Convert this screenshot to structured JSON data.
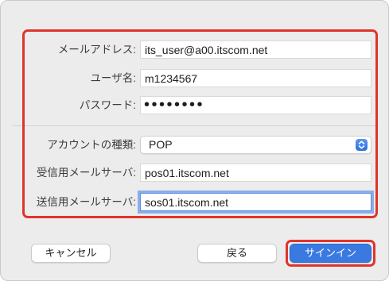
{
  "form": {
    "email": {
      "label": "メールアドレス:",
      "value": "its_user@a00.itscom.net"
    },
    "username": {
      "label": "ユーザ名:",
      "value": "m1234567"
    },
    "password": {
      "label": "パスワード:",
      "value": "••••••••"
    },
    "account_type": {
      "label": "アカウントの種類:",
      "value": "POP"
    },
    "incoming_server": {
      "label": "受信用メールサーバ:",
      "value": "pos01.itscom.net"
    },
    "outgoing_server": {
      "label": "送信用メールサーバ:",
      "value": "sos01.itscom.net"
    }
  },
  "buttons": {
    "cancel": "キャンセル",
    "back": "戻る",
    "sign_in": "サインイン"
  },
  "colors": {
    "highlight": "#e0342b",
    "accent": "#3a7ae0",
    "background": "#ececec"
  },
  "icons": {
    "account_type_popup": "chevron-up-down-icon"
  }
}
